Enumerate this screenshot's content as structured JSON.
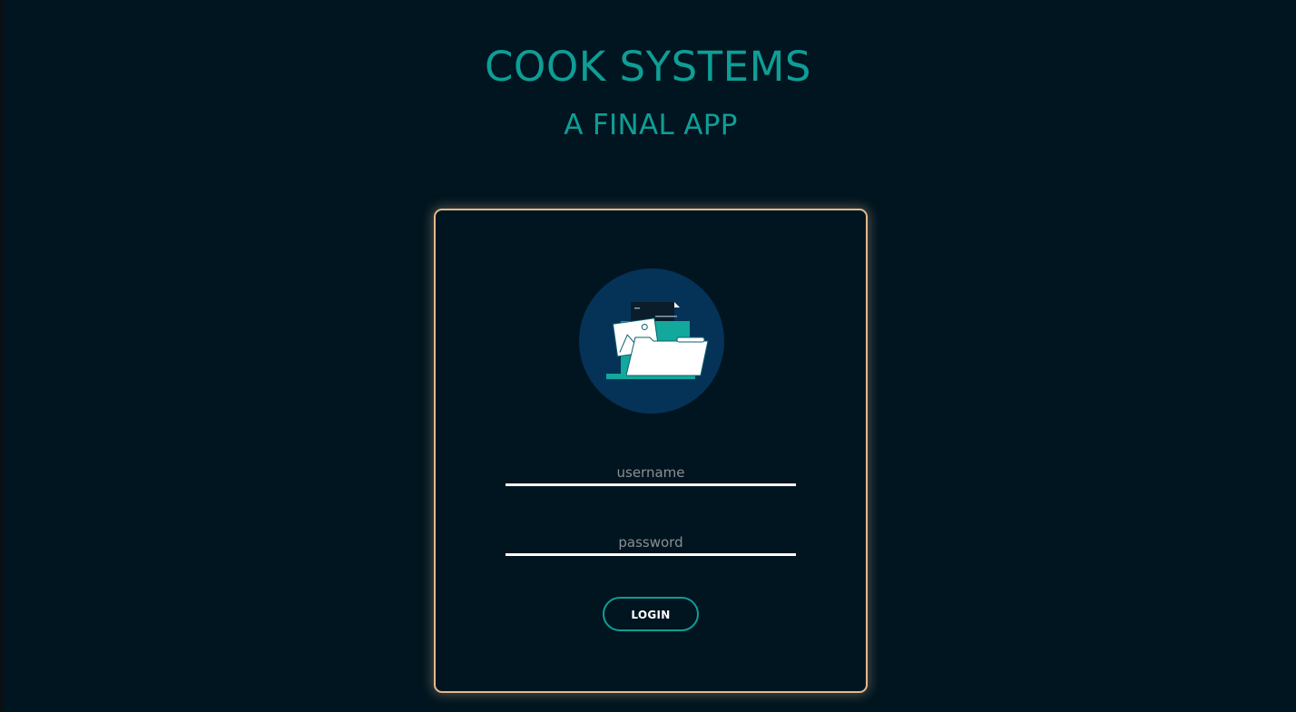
{
  "header": {
    "title": "COOK SYSTEMS",
    "subtitle": "A FINAL APP"
  },
  "login_form": {
    "logo_icon": "folder-documents-icon",
    "username": {
      "placeholder": "username",
      "value": ""
    },
    "password": {
      "placeholder": "password",
      "value": ""
    },
    "login_label": "LOGIN"
  },
  "colors": {
    "background": "#011520",
    "accent": "#0e9e96",
    "card_border": "#e0b98d",
    "logo_circle": "#053358"
  }
}
